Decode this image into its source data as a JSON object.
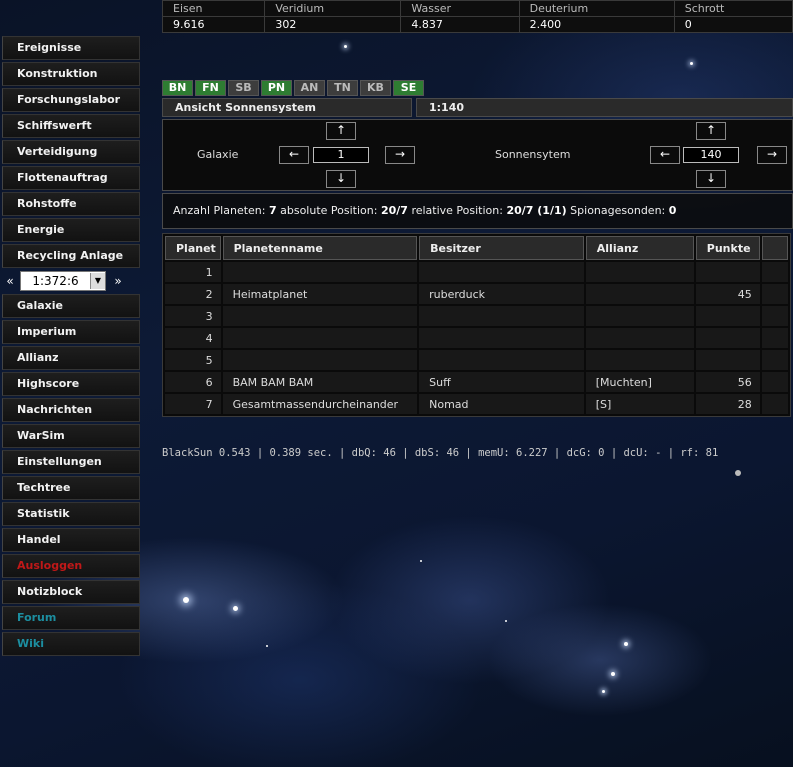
{
  "resources": {
    "headers": [
      "Eisen",
      "Veridium",
      "Wasser",
      "Deuterium",
      "Schrott"
    ],
    "values": [
      "9.616",
      "302",
      "4.837",
      "2.400",
      "0"
    ]
  },
  "sidebar": {
    "items_top": [
      "Ereignisse",
      "Konstruktion",
      "Forschungslabor",
      "Schiffswerft",
      "Verteidigung",
      "Flottenauftrag",
      "Rohstoffe",
      "Energie",
      "Recycling Anlage"
    ],
    "coord_prev": "«",
    "coord_value": "1:372:6",
    "coord_next": "»",
    "items_mid": [
      "Galaxie",
      "Imperium",
      "Allianz",
      "Highscore",
      "Nachrichten",
      "WarSim"
    ],
    "items_bottom": [
      "Einstellungen",
      "Techtree",
      "Statistik",
      "Handel"
    ],
    "logout": "Ausloggen",
    "notes": "Notizblock",
    "forum": "Forum",
    "wiki": "Wiki"
  },
  "tabs": [
    {
      "label": "BN",
      "active": true
    },
    {
      "label": "FN",
      "active": true
    },
    {
      "label": "SB",
      "active": false
    },
    {
      "label": "PN",
      "active": true
    },
    {
      "label": "AN",
      "active": false
    },
    {
      "label": "TN",
      "active": false
    },
    {
      "label": "KB",
      "active": false
    },
    {
      "label": "SE",
      "active": true
    }
  ],
  "system": {
    "view_label": "Ansicht Sonnensystem",
    "coord": "1:140",
    "galaxy_label": "Galaxie",
    "galaxy_value": "1",
    "system_label": "Sonnensytem",
    "system_value": "140",
    "arrow_up": "↑",
    "arrow_down": "↓",
    "arrow_left": "←",
    "arrow_right": "→"
  },
  "info": {
    "planets_label": "Anzahl Planeten:",
    "planets_value": "7",
    "abs_label": "absolute Position:",
    "abs_value": "20/7",
    "rel_label": "relative Position:",
    "rel_value": "20/7 (1/1)",
    "spy_label": "Spionagesonden:",
    "spy_value": "0"
  },
  "planet_table": {
    "headers": [
      "Planet",
      "Planetenname",
      "Besitzer",
      "Allianz",
      "Punkte",
      ""
    ],
    "rows": [
      [
        "1",
        "",
        "",
        "",
        ""
      ],
      [
        "2",
        "Heimatplanet",
        "ruberduck",
        "",
        "45"
      ],
      [
        "3",
        "",
        "",
        "",
        ""
      ],
      [
        "4",
        "",
        "",
        "",
        ""
      ],
      [
        "5",
        "",
        "",
        "",
        ""
      ],
      [
        "6",
        "BAM BAM BAM",
        "Suff",
        "[Muchten]",
        "56"
      ],
      [
        "7",
        "Gesamtmassendurcheinander",
        "Nomad",
        "[S]",
        "28"
      ]
    ]
  },
  "footer": "BlackSun 0.543 | 0.389 sec. | dbQ: 46 | dbS: 46 | memU: 6.227 | dcG: 0 | dcU: - | rf: 81"
}
